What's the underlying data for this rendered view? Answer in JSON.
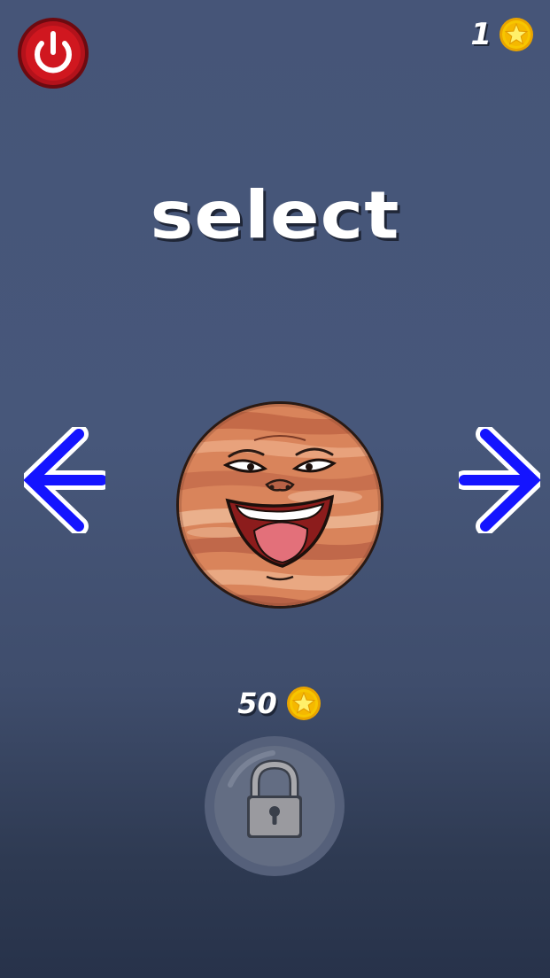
{
  "screen": {
    "title": "select"
  },
  "header": {
    "power_icon": "power-icon",
    "coin_balance": "1",
    "coin_icon": "star-coin-icon"
  },
  "navigation": {
    "prev_icon": "arrow-left-icon",
    "next_icon": "arrow-right-icon"
  },
  "character": {
    "icon": "laughing-planet-icon"
  },
  "unlock": {
    "price": "50",
    "coin_icon": "star-coin-icon",
    "lock_icon": "padlock-icon",
    "locked": true
  },
  "colors": {
    "power_button": "#c0121a",
    "coin_gold": "#f7c600",
    "arrow_blue": "#1414ff",
    "planet_base": "#d47a55"
  }
}
